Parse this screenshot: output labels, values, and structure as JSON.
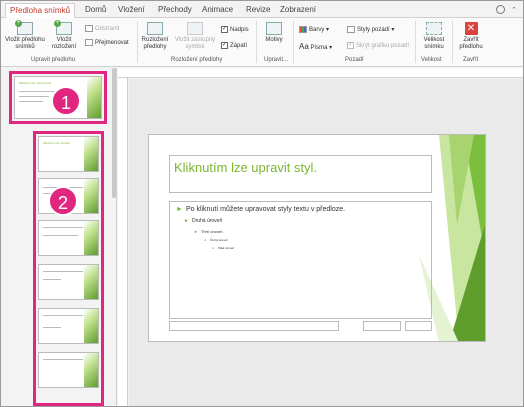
{
  "tabs": [
    {
      "label": "Předloha snímků",
      "active": true
    },
    {
      "label": "Domů"
    },
    {
      "label": "Vložení"
    },
    {
      "label": "Přechody"
    },
    {
      "label": "Animace"
    },
    {
      "label": "Revize"
    },
    {
      "label": "Zobrazení"
    }
  ],
  "ribbon": {
    "insert_master": "Vložit předlohu snímků",
    "insert_layout": "Vložit rozložení",
    "delete": "Odstranit",
    "rename": "Přejmenovat",
    "group_edit_master": "Upravit předlohu",
    "master_layout": "Rozložení předlohy",
    "insert_placeholder": "Vložit zástupný symbol",
    "title_chk": "Nadpis",
    "footer_chk": "Zápatí",
    "group_master_layout": "Rozložení předlohy",
    "themes": "Motivy",
    "group_edit_theme": "Upravit...",
    "colors": "Barvy",
    "fonts": "Písma",
    "bg_styles": "Styly pozadí",
    "hide_bg": "Skrýt grafiku pozadí",
    "group_background": "Pozadí",
    "slide_size": "Velikost snímku",
    "group_size": "Velikost",
    "close_master": "Zavřít předlohu",
    "group_close": "Zavřít"
  },
  "badges": {
    "one": "1",
    "two": "2"
  },
  "slide": {
    "title": "Kliknutím lze upravit styl.",
    "levels": [
      "Po kliknutí můžete upravovat styly textu v předloze.",
      "Druhá úroveň",
      "Třetí úroveň",
      "Čtvrtá úroveň",
      "Pátá úroveň"
    ]
  },
  "colors": {
    "accent_green": "#7ab82e",
    "highlight_pink": "#e0267f",
    "tab_red": "#c0392b"
  }
}
